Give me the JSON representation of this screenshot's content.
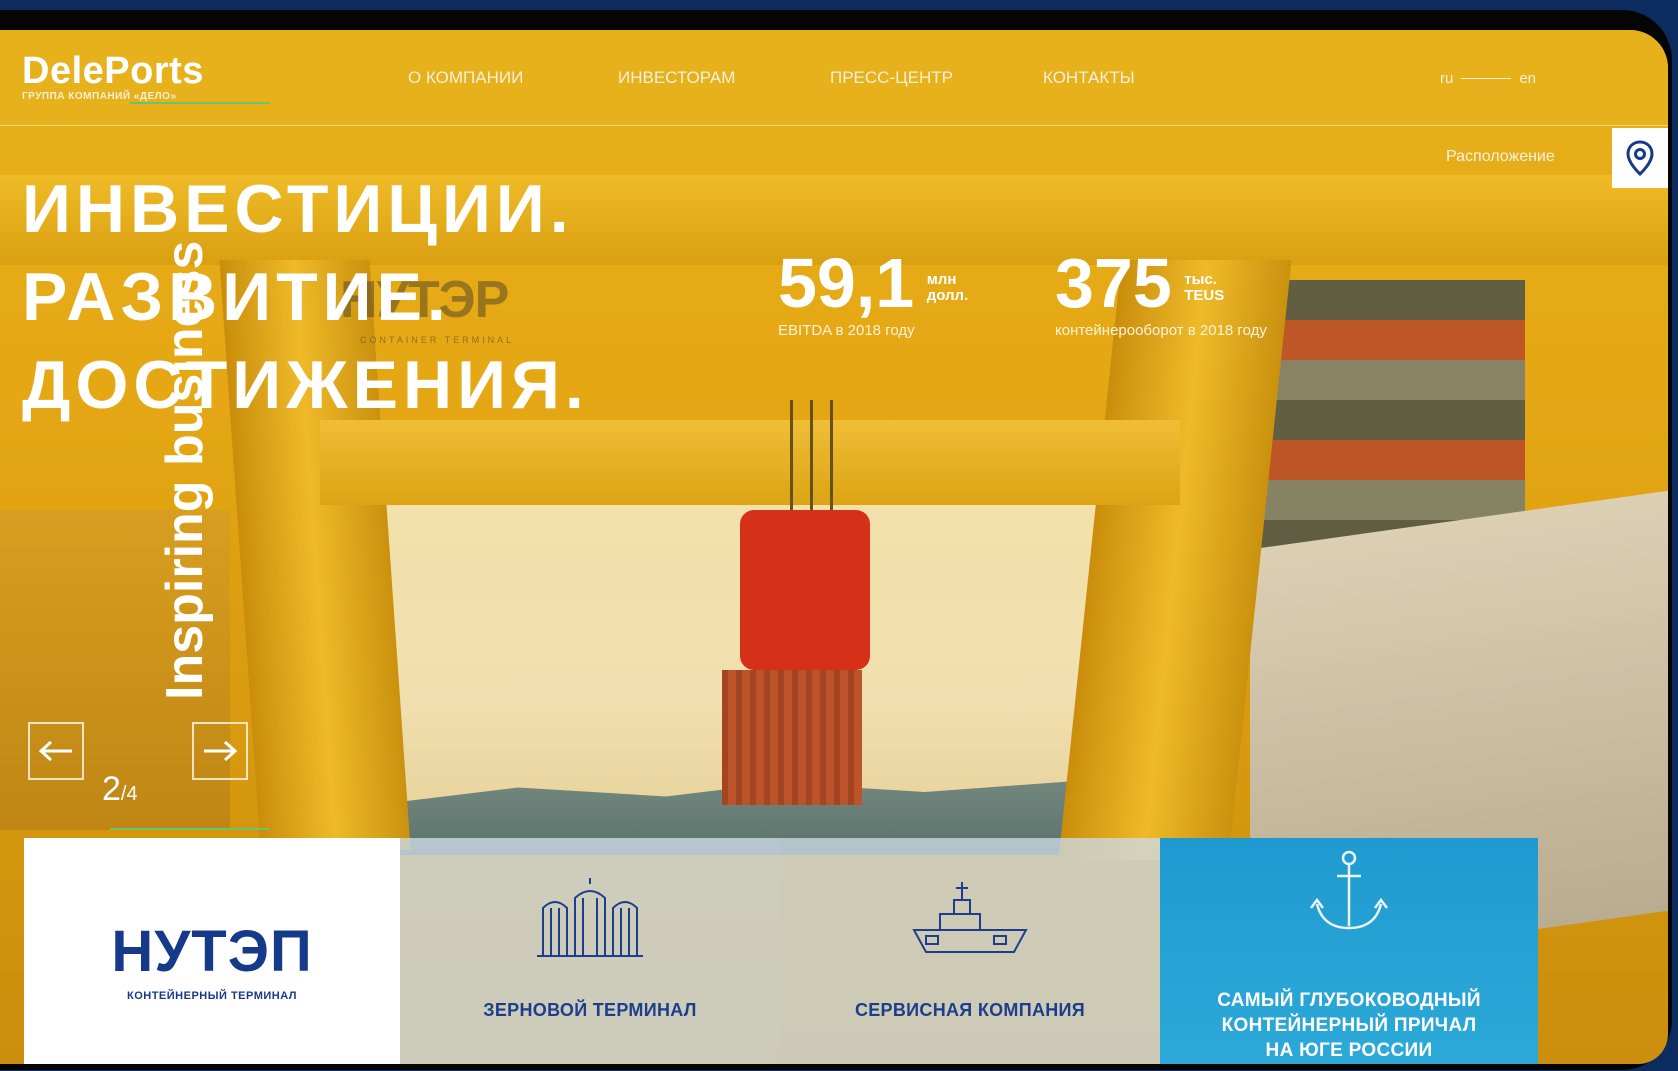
{
  "brand": {
    "name_part1": "Dele",
    "name_part2": "Ports",
    "subtitle": "ГРУППА КОМПАНИЙ «ДЕЛО»"
  },
  "nav": {
    "items": [
      {
        "label": "О КОМПАНИИ"
      },
      {
        "label": "ИНВЕСТОРАМ"
      },
      {
        "label": "ПРЕСС-ЦЕНТР"
      },
      {
        "label": "КОНТАКТЫ"
      }
    ]
  },
  "lang": {
    "ru": "ru",
    "en": "en"
  },
  "location": {
    "label": "Расположение",
    "icon": "map-pin-icon"
  },
  "hero": {
    "line1": "ИНВЕСТИЦИИ.",
    "line2": "РАЗВИТИЕ.",
    "line3": "ДОСТИЖЕНИЯ.",
    "overlay_text": "Inspiring business",
    "faint_logo": "НУТЭР",
    "faint_sub": "CONTAINER TERMINAL"
  },
  "stats": [
    {
      "value": "59,1",
      "unit1": "млн",
      "unit2": "долл.",
      "caption": "EBITDA в 2018 году"
    },
    {
      "value": "375",
      "unit1": "тыс.",
      "unit2": "TEUS",
      "caption": "контейнерооборот в 2018 году"
    }
  ],
  "slider": {
    "current": "2",
    "total": "4",
    "prev_icon": "arrow-left-icon",
    "next_icon": "arrow-right-icon"
  },
  "cards": [
    {
      "title": "НУТЭП",
      "subtitle": "КОНТЕЙНЕРНЫЙ ТЕРМИНАЛ"
    },
    {
      "label": "ЗЕРНОВОЙ ТЕРМИНАЛ",
      "icon": "silo-icon"
    },
    {
      "label": "СЕРВИСНАЯ КОМПАНИЯ",
      "icon": "ship-icon"
    },
    {
      "line1": "САМЫЙ ГЛУБОКОВОДНЫЙ",
      "line2": "КОНТЕЙНЕРНЫЙ ПРИЧАЛ",
      "line3": "НА ЮГЕ РОССИИ",
      "icon": "anchor-icon"
    }
  ],
  "colors": {
    "accent_yellow": "#e8b21c",
    "brand_blue": "#163a8a",
    "accent_green": "#6bc36b",
    "card_blue": "#1f9ad0"
  }
}
